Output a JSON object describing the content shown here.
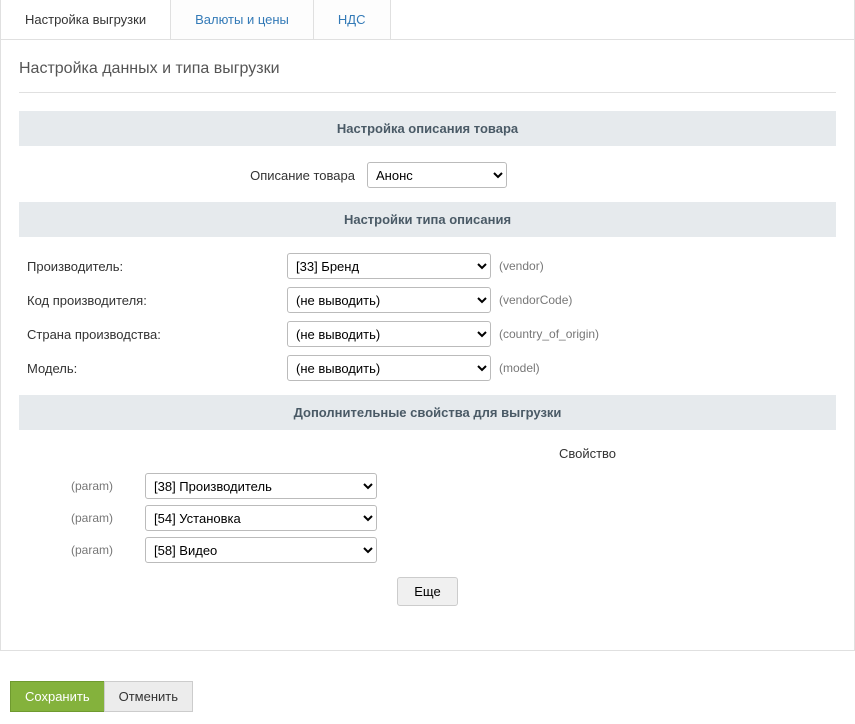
{
  "tabs": {
    "export_settings": "Настройка выгрузки",
    "currencies_prices": "Валюты и цены",
    "vat": "НДС"
  },
  "page_title": "Настройка данных и типа выгрузки",
  "sections": {
    "product_description_settings": "Настройка описания товара",
    "description_type_settings": "Настройки типа описания",
    "additional_export_properties": "Дополнительные свойства для выгрузки"
  },
  "product_description": {
    "label": "Описание товара",
    "selected": "Анонс"
  },
  "description_type": {
    "vendor": {
      "label": "Производитель:",
      "selected": "[33] Бренд",
      "hint": "(vendor)"
    },
    "vendor_code": {
      "label": "Код производителя:",
      "selected": "(не выводить)",
      "hint": "(vendorCode)"
    },
    "country": {
      "label": "Страна производства:",
      "selected": "(не выводить)",
      "hint": "(country_of_origin)"
    },
    "model": {
      "label": "Модель:",
      "selected": "(не выводить)",
      "hint": "(model)"
    }
  },
  "properties": {
    "heading": "Свойство",
    "param_label": "(param)",
    "params": {
      "p1": "[38] Производитель",
      "p2": "[54] Установка",
      "p3": "[58] Видео"
    },
    "more_button": "Еще"
  },
  "buttons": {
    "save": "Сохранить",
    "cancel": "Отменить"
  }
}
